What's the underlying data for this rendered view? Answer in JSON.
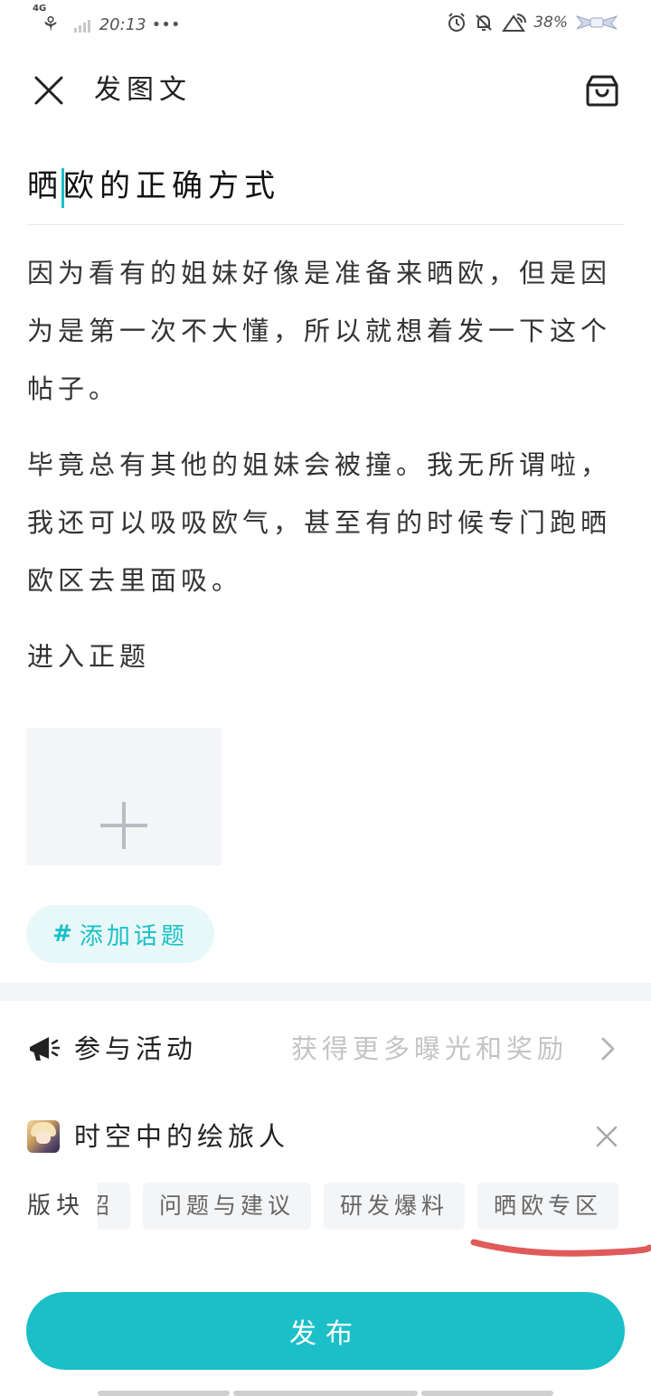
{
  "status_bar": {
    "network": "4G",
    "time": "20:13",
    "more": "•••",
    "battery": "38%"
  },
  "header": {
    "title": "发图文",
    "close_icon": "close-icon",
    "drafts_icon": "drafts-box-icon"
  },
  "post": {
    "title_before_caret": "晒",
    "title_after_caret": "欧的正确方式",
    "paragraphs": [
      "因为看有的姐妹好像是准备来晒欧，但是因为是第一次不大懂，所以就想着发一下这个帖子。",
      "毕竟总有其他的姐妹会被撞。我无所谓啦，我还可以吸吸欧气，甚至有的时候专门跑晒欧区去里面吸。",
      "进入正题"
    ]
  },
  "image_picker": {
    "icon": "plus-icon"
  },
  "topic": {
    "hash": "#",
    "label": "添加话题"
  },
  "activity": {
    "icon": "megaphone-icon",
    "label": "参与活动",
    "hint": "获得更多曝光和奖励",
    "chevron": "chevron-right-icon"
  },
  "game": {
    "name": "时空中的绘旅人",
    "remove_icon": "close-icon"
  },
  "sections": {
    "label": "版块",
    "chips": [
      "介绍",
      "问题与建议",
      "研发爆料",
      "晒欧专区"
    ]
  },
  "publish": {
    "label": "发布"
  },
  "colors": {
    "accent": "#1bbfc8",
    "annotation": "#e05a5a",
    "chip_bg": "#f4f5f7"
  }
}
